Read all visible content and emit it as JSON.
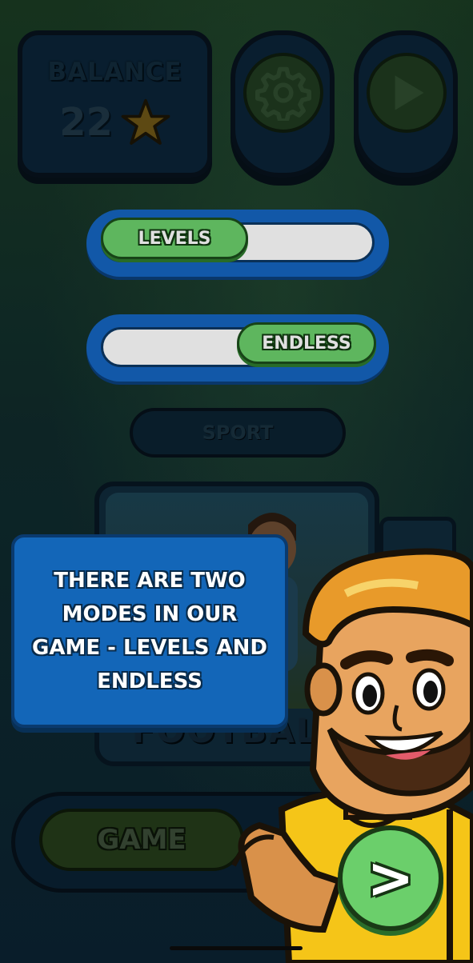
{
  "header": {
    "balance_label": "BALANCE",
    "balance_value": "22",
    "currency_icon": "star-icon",
    "settings_icon": "gear-icon",
    "play_icon": "play-icon"
  },
  "modes": {
    "levels_label": "LEVELS",
    "endless_label": "ENDLESS"
  },
  "category": {
    "tab_label": "SPORT",
    "card_label": "FOOTBALL"
  },
  "game_toggle": {
    "label": "GAME"
  },
  "tutorial": {
    "message": "THERE ARE TWO MODES IN OUR GAME - LEVELS AND ENDLESS",
    "next_label": ">"
  },
  "colors": {
    "accent_blue": "#1565c0",
    "accent_green": "#6bd06b",
    "star": "#f2c230"
  }
}
